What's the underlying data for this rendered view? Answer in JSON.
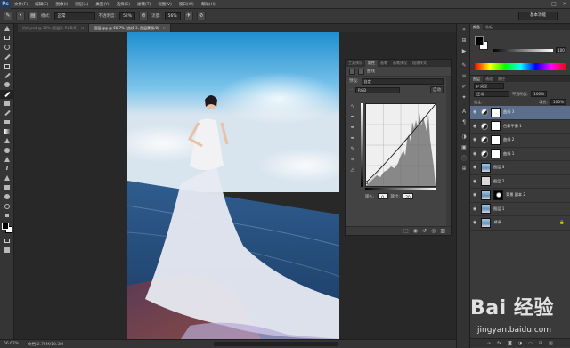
{
  "app": {
    "logo": "Ps"
  },
  "menu": [
    "文件(F)",
    "编辑(E)",
    "图像(I)",
    "图层(L)",
    "类型(Y)",
    "选择(S)",
    "滤镜(T)",
    "视图(V)",
    "窗口(W)",
    "帮助(H)"
  ],
  "window_controls": [
    "—",
    "□",
    "×"
  ],
  "options_bar": {
    "mode_label": "模式:",
    "mode_value": "正常",
    "opacity_label": "不透明度:",
    "opacity_value": "52%",
    "flow_label": "流量:",
    "flow_value": "56%",
    "workspace": "基本功能"
  },
  "tabs": [
    {
      "label": "约约.psd @ 30% (图层0, RGB/8)",
      "active": false
    },
    {
      "label": "图层.jpg @ 66.7% (曲线 3, 图层蒙版/8)",
      "active": true
    }
  ],
  "tab_close": "×",
  "status": {
    "zoom": "66.67%",
    "doc": "文档:2.75M/10.3M"
  },
  "properties": {
    "tabs": [
      "工具预设",
      "属性",
      "画笔",
      "画笔预设",
      "段落样式"
    ],
    "active_tab": 1,
    "title": "曲线",
    "preset_label": "预设:",
    "preset_value": "自定",
    "channel_value": "RGB",
    "auto_label": "自动",
    "input_label": "输入:",
    "input_value": "0",
    "output_label": "输出:",
    "output_value": "20"
  },
  "color_panel": {
    "tabs": [
      "颜色",
      "色板"
    ],
    "slider_value": "100"
  },
  "layers_panel": {
    "tabs": [
      "图层",
      "通道",
      "路径"
    ],
    "kind_label": "ρ 类型",
    "blend_value": "正常",
    "opacity_label": "不透明度:",
    "opacity_value": "100%",
    "lock_label": "锁定:",
    "fill_label": "填充:",
    "fill_value": "100%",
    "layers": [
      {
        "name": "曲线 3",
        "thumb": "adj",
        "selected": true
      },
      {
        "name": "色彩平衡 1",
        "thumb": "adj",
        "selected": false
      },
      {
        "name": "曲线 2",
        "thumb": "adj",
        "selected": false
      },
      {
        "name": "曲线 1",
        "thumb": "adj",
        "selected": false
      },
      {
        "name": "图层 3",
        "thumb": "photo",
        "selected": false
      },
      {
        "name": "图层 2",
        "thumb": "gray",
        "selected": false
      },
      {
        "name": "背景 副本 2",
        "thumb": "mask",
        "selected": false
      },
      {
        "name": "图层 1",
        "thumb": "photo",
        "selected": false
      },
      {
        "name": "背景",
        "thumb": "photo",
        "selected": false,
        "italic": true,
        "locked": true
      }
    ]
  },
  "watermark": {
    "text": "Bai 经验",
    "url": "jingyan.baidu.com"
  }
}
